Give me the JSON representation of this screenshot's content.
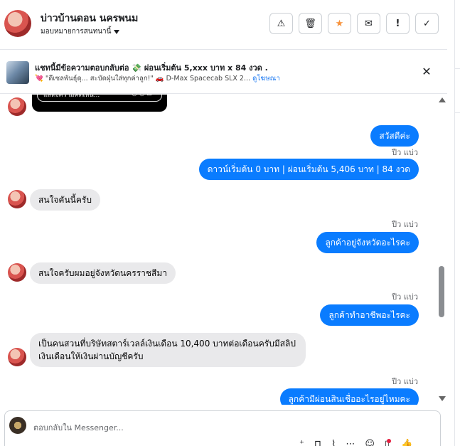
{
  "header": {
    "title": "บ่าวบ้านดอน นครพนม",
    "assign_label": "มอบหมายการสนทนานี้",
    "buttons": [
      {
        "icon": "warning-icon",
        "glyph": "⚠"
      },
      {
        "icon": "trash-icon",
        "glyph": "🗑"
      },
      {
        "icon": "star-icon",
        "glyph": "★"
      },
      {
        "icon": "mark-unread-icon",
        "glyph": "✉"
      },
      {
        "icon": "priority-icon",
        "glyph": "!"
      },
      {
        "icon": "done-check-icon",
        "glyph": "✓"
      }
    ]
  },
  "ad": {
    "title": "แชทนี้มีข้อความตอบกลับต่อ 💸 ผ่อนเริ่มต้น 5,xxx บาท x 84 งวด .",
    "desc_prefix": "💘 \"ดีเซลพันธุ์ดุ... สะบัดฝุ่นใส่ทุกค่าลูก!\" 🚗 D-Max Spacecab SLX 2...",
    "desc_link": "ดูโฆษณา",
    "close_glyph": "✕"
  },
  "thread": {
    "attachment_placeholder": "แสดงความคิดเห็น...",
    "attachment_dots": "◎ ◎ ⊡",
    "messages": [
      {
        "side": "out",
        "text": "สวัสดีค่ะ"
      },
      {
        "side": "seen",
        "text": "ปีว แบ่ว"
      },
      {
        "side": "out",
        "text": "ดาวน์เริ่มต้น 0 บาท | ผ่อนเริ่มต้น 5,406 บาท | 84 งวด"
      },
      {
        "side": "in",
        "text": "สนใจคันนี้ครับ"
      },
      {
        "side": "seen",
        "text": "ปีว แบ่ว"
      },
      {
        "side": "out",
        "text": "ลูกค้าอยู่จังหวัดอะไรคะ"
      },
      {
        "side": "in",
        "text": "สนใจครับผมอยู่จังหวัดนครราชสีมา"
      },
      {
        "side": "seen",
        "text": "ปีว แบ่ว"
      },
      {
        "side": "out",
        "text": "ลูกค้าทำอาชีพอะไรคะ"
      },
      {
        "side": "in",
        "line1": "เป็นคนสวนที่บริษัทสตาร์เวลล์เงินเดือน 10,400 บาทต่อเดือนครับมีสลิป",
        "line2": "เงินเดือนให้เงินผ่านบัญชีครับ"
      },
      {
        "side": "seen",
        "text": "ปีว แบ่ว"
      },
      {
        "side": "out",
        "text": "ลูกค้ามีผ่อนสินเชื่ออะไรอยู่ไหมคะ"
      }
    ]
  },
  "composer": {
    "placeholder": "ตอบกลับใน Messenger...",
    "icons": [
      {
        "icon": "add-person-icon",
        "glyph": "⁺"
      },
      {
        "icon": "shopping-bag-icon",
        "glyph": "⊓"
      },
      {
        "icon": "attach-icon",
        "glyph": "⌇"
      },
      {
        "icon": "more-icon",
        "glyph": "⋯"
      },
      {
        "icon": "emoji-icon",
        "glyph": "☺"
      },
      {
        "icon": "saved-reply-icon",
        "glyph": "▯"
      },
      {
        "icon": "thumbs-up-icon",
        "glyph": "👍"
      }
    ]
  },
  "colors": {
    "outgoing_bubble": "#0a7cff",
    "incoming_bubble": "#e9e9eb",
    "star": "#f7923b"
  }
}
